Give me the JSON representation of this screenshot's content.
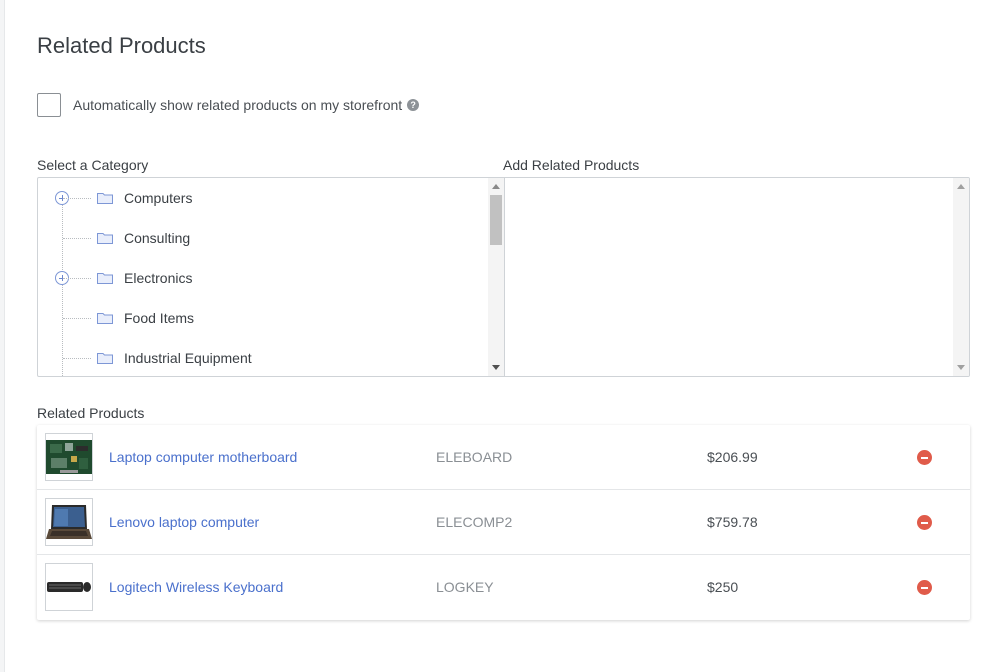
{
  "page": {
    "title": "Related Products"
  },
  "auto_show": {
    "label": "Automatically show related products on my storefront",
    "checked": false,
    "help_icon": "question-circle-icon"
  },
  "category_panel": {
    "label": "Select a Category",
    "items": [
      {
        "label": "Computers",
        "expandable": true
      },
      {
        "label": "Consulting",
        "expandable": false
      },
      {
        "label": "Electronics",
        "expandable": true
      },
      {
        "label": "Food Items",
        "expandable": false
      },
      {
        "label": "Industrial Equipment",
        "expandable": false
      }
    ]
  },
  "products_panel": {
    "label": "Add Related Products"
  },
  "related": {
    "label": "Related Products",
    "rows": [
      {
        "name": "Laptop computer motherboard",
        "sku": "ELEBOARD",
        "price": "$206.99",
        "thumb": "motherboard-image"
      },
      {
        "name": "Lenovo laptop computer",
        "sku": "ELECOMP2",
        "price": "$759.78",
        "thumb": "laptop-image"
      },
      {
        "name": "Logitech Wireless Keyboard",
        "sku": "LOGKEY",
        "price": "$250",
        "thumb": "keyboard-image"
      }
    ]
  },
  "colors": {
    "link": "#4a70cc",
    "remove": "#e05b4a",
    "folder": "#7d97d6"
  }
}
